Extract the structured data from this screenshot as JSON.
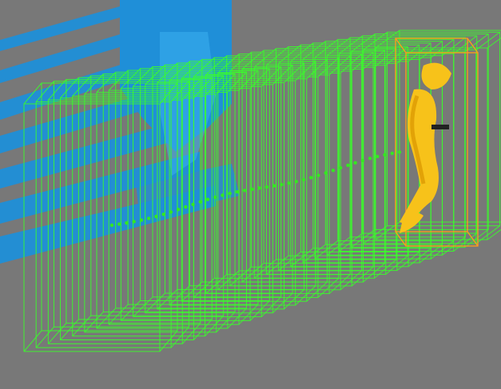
{
  "viewport": {
    "background": "#787878"
  },
  "point_cloud": {
    "color": "#1f8fd8",
    "highlight_color": "#3bb0f0"
  },
  "trajectory": {
    "box_color": "#39ff2a",
    "center_color": "#34e820",
    "box_count": 30
  },
  "target": {
    "box_color": "#ff9d1a",
    "figure_color": "#f7c21a",
    "figure_shadow": "#d99400"
  }
}
